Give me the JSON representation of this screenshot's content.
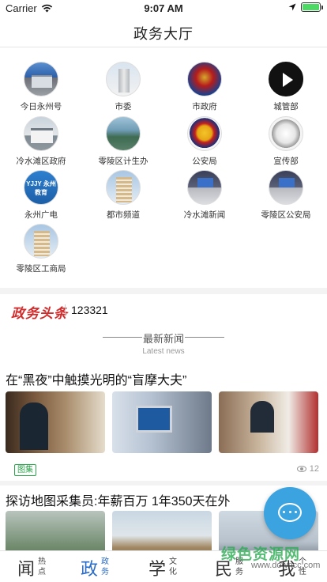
{
  "status_bar": {
    "carrier": "Carrier",
    "time": "9:07 AM",
    "battery_level": 1.0
  },
  "header": {
    "title": "政务大厅"
  },
  "grid": {
    "items": [
      {
        "label": "今日永州号",
        "icon": "blue-building-avatar"
      },
      {
        "label": "市委",
        "icon": "tower-avatar"
      },
      {
        "label": "市政府",
        "icon": "emblem-avatar"
      },
      {
        "label": "城管部",
        "icon": "play-icon"
      },
      {
        "label": "冷水滩区政府",
        "icon": "gov-building-avatar"
      },
      {
        "label": "零陵区计生办",
        "icon": "city-avatar"
      },
      {
        "label": "公安局",
        "icon": "police-emblem-icon"
      },
      {
        "label": "宣传部",
        "icon": "national-emblem-icon"
      },
      {
        "label": "永州广电",
        "icon": "edu-logo-avatar"
      },
      {
        "label": "都市频道",
        "icon": "apartment-avatar"
      },
      {
        "label": "冷水滩新闻",
        "icon": "newsroom-avatar"
      },
      {
        "label": "零陵区公安局",
        "icon": "newsroom-avatar"
      },
      {
        "label": "零陵区工商局",
        "icon": "apartment-avatar"
      }
    ],
    "edu_logo_text": "YJJY 永州教育"
  },
  "headline": {
    "logo_text": "政务头条",
    "text": "123321"
  },
  "news_section": {
    "title": "最新新闻",
    "subtitle": "Latest news"
  },
  "articles": [
    {
      "title": "在“黑夜”中触摸光明的“盲摩大夫”",
      "tag": "图集",
      "views": "12"
    },
    {
      "title": "探访地图采集员:年薪百万 1年350天在外"
    }
  ],
  "tab_bar": {
    "tabs": [
      {
        "big": "闻",
        "small": "热点"
      },
      {
        "big": "政",
        "small": "政务"
      },
      {
        "big": "学",
        "small": "文化"
      },
      {
        "big": "民",
        "small": "服务"
      },
      {
        "big": "我",
        "small": "个性"
      }
    ],
    "active_index": 1
  },
  "watermark": {
    "text": "绿色资源网",
    "url": "www.downcc.com"
  },
  "colors": {
    "accent": "#2a6cc7",
    "headline_red": "#d12b2b",
    "fab": "#3ba3e0",
    "tag_green": "#2aa34a"
  }
}
